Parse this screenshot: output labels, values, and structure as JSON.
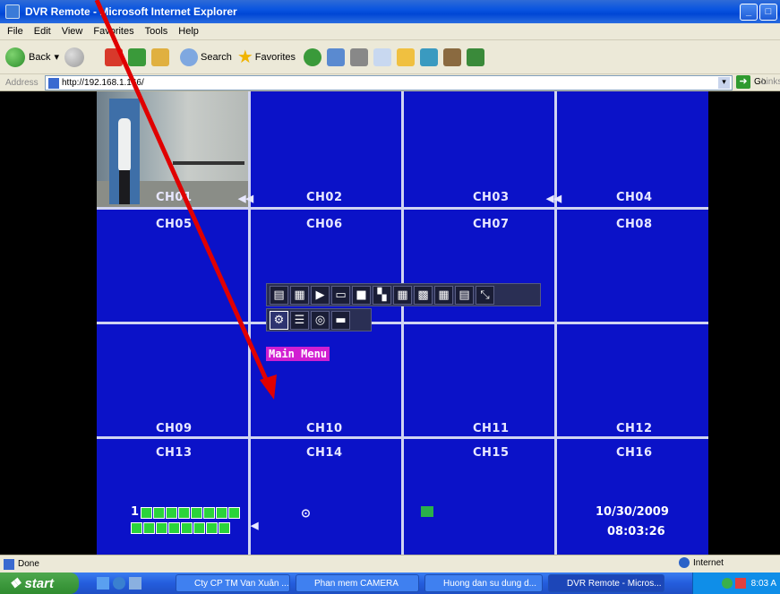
{
  "window": {
    "title": "DVR Remote - Microsoft Internet Explorer"
  },
  "menu": [
    "File",
    "Edit",
    "View",
    "Favorites",
    "Tools",
    "Help"
  ],
  "toolbar": {
    "back": "Back",
    "search": "Search",
    "favorites": "Favorites"
  },
  "address": {
    "label": "Address",
    "url": "http://192.168.1.166/",
    "go": "Go",
    "links": "Links"
  },
  "dvr": {
    "channels": [
      "CH01",
      "CH02",
      "CH03",
      "CH04",
      "CH05",
      "CH06",
      "CH07",
      "CH08",
      "CH09",
      "CH10",
      "CH11",
      "CH12",
      "CH13",
      "CH14",
      "CH15",
      "CH16"
    ],
    "popup_label": "Main Menu",
    "status_number": "1",
    "date": "10/30/2009",
    "time": "08:03:26"
  },
  "statusbar": {
    "text": "Done",
    "zone": "Internet"
  },
  "taskbar": {
    "start": "start",
    "tasks": [
      "Cty CP TM Van Xuân ...",
      "Phan mem CAMERA",
      "Huong dan su dung d...",
      "DVR Remote - Micros..."
    ],
    "clock": "8:03 A"
  },
  "colors": {
    "dvr_bg": "#0b12c8",
    "highlight": "#d11fd1",
    "arrow": "#e00000"
  }
}
